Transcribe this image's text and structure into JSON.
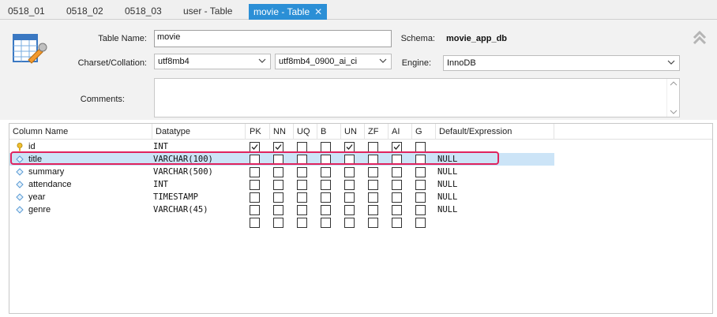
{
  "tabs": [
    {
      "label": "0518_01"
    },
    {
      "label": "0518_02"
    },
    {
      "label": "0518_03"
    },
    {
      "label": "user - Table"
    },
    {
      "label": "movie - Table",
      "active": true
    }
  ],
  "form": {
    "table_name_label": "Table Name:",
    "table_name_value": "movie",
    "schema_label": "Schema:",
    "schema_value": "movie_app_db",
    "charset_label": "Charset/Collation:",
    "charset_value": "utf8mb4",
    "collation_value": "utf8mb4_0900_ai_ci",
    "engine_label": "Engine:",
    "engine_value": "InnoDB",
    "comments_label": "Comments:",
    "comments_value": ""
  },
  "grid": {
    "headers": [
      "Column Name",
      "Datatype",
      "PK",
      "NN",
      "UQ",
      "B",
      "UN",
      "ZF",
      "AI",
      "G",
      "Default/Expression"
    ],
    "rows": [
      {
        "name": "id",
        "type": "INT",
        "flags": [
          true,
          true,
          false,
          false,
          true,
          false,
          true,
          false
        ],
        "default": "",
        "icon": "key-icon"
      },
      {
        "name": "title",
        "type": "VARCHAR(100)",
        "flags": [
          false,
          false,
          false,
          false,
          false,
          false,
          false,
          false
        ],
        "default": "NULL",
        "icon": "diamond-icon",
        "selected": true
      },
      {
        "name": "summary",
        "type": "VARCHAR(500)",
        "flags": [
          false,
          false,
          false,
          false,
          false,
          false,
          false,
          false
        ],
        "default": "NULL",
        "icon": "diamond-icon"
      },
      {
        "name": "attendance",
        "type": "INT",
        "flags": [
          false,
          false,
          false,
          false,
          false,
          false,
          false,
          false
        ],
        "default": "NULL",
        "icon": "diamond-icon"
      },
      {
        "name": "year",
        "type": "TIMESTAMP",
        "flags": [
          false,
          false,
          false,
          false,
          false,
          false,
          false,
          false
        ],
        "default": "NULL",
        "icon": "diamond-icon"
      },
      {
        "name": "genre",
        "type": "VARCHAR(45)",
        "flags": [
          false,
          false,
          false,
          false,
          false,
          false,
          false,
          false
        ],
        "default": "NULL",
        "icon": "diamond-icon"
      },
      {
        "name": "",
        "type": "",
        "flags": [
          false,
          false,
          false,
          false,
          false,
          false,
          false,
          false
        ],
        "default": "",
        "icon": ""
      }
    ]
  },
  "colors": {
    "active_tab": "#2b8fd6",
    "selected_row": "#cce4f7",
    "highlight_box": "#e0245e"
  }
}
